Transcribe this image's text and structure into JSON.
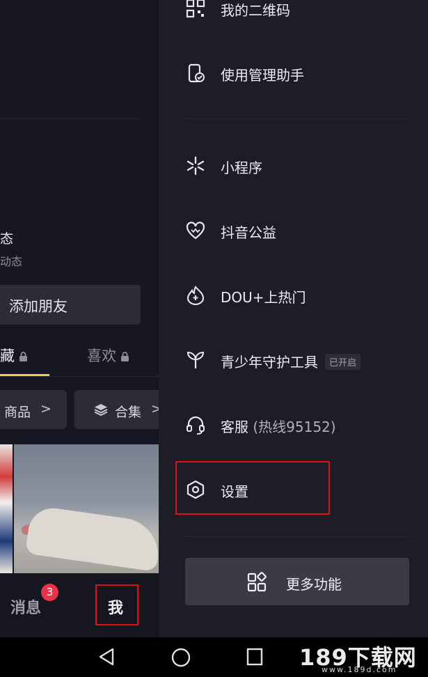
{
  "left_panel": {
    "dynamic_title": "态",
    "dynamic_subtitle": "动态",
    "add_friend_label": "添加朋友",
    "tabs": [
      {
        "label": "藏",
        "locked": true
      },
      {
        "label": "喜欢",
        "locked": true
      }
    ],
    "chips": [
      {
        "label": "商品",
        "chevron": ">"
      },
      {
        "label": "合集",
        "chevron": ">"
      }
    ],
    "bottom_tabs": {
      "messages_label": "消息",
      "messages_badge": "3",
      "me_label": "我"
    }
  },
  "drawer": {
    "items": [
      {
        "label": "我的二维码",
        "icon": "qr-code-icon"
      },
      {
        "label": "使用管理助手",
        "icon": "usage-manager-icon"
      },
      {
        "label": "小程序",
        "icon": "mini-program-icon"
      },
      {
        "label": "抖音公益",
        "icon": "charity-heart-icon"
      },
      {
        "label": "DOU+上热门",
        "icon": "dou-plus-icon"
      },
      {
        "label": "青少年守护工具",
        "icon": "sprout-icon",
        "tag": "已开启"
      },
      {
        "label": "客服",
        "sub": "(热线95152)",
        "icon": "headset-icon"
      },
      {
        "label": "设置",
        "icon": "settings-hexagon-icon"
      }
    ],
    "more_button_label": "更多功能"
  },
  "watermark": {
    "brand": "189下载网",
    "url": "www.189d.com"
  },
  "colors": {
    "background": "#15161f",
    "drawer": "#1c1d27",
    "highlight_box": "#dd1111",
    "badge": "#e8334b",
    "tab_underline": "#f2c94c"
  }
}
